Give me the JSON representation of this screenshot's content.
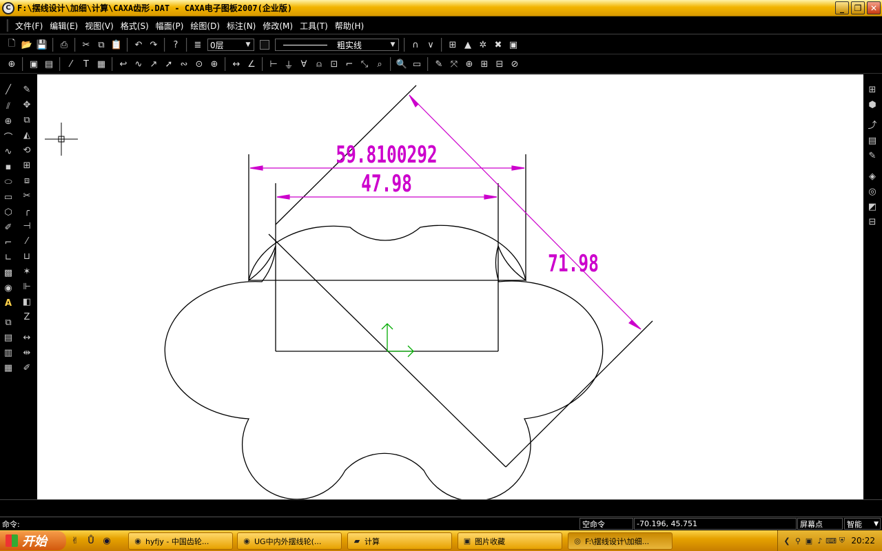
{
  "window": {
    "app_icon": "caxa-logo-icon",
    "title": "F:\\摆线设计\\加细\\计算\\CAXA齿形.DAT - CAXA电子图板2007(企业版)",
    "buttons": {
      "minimize": "_",
      "restore": "❐",
      "close": "✕"
    }
  },
  "menubar": {
    "items": [
      "文件(F)",
      "编辑(E)",
      "视图(V)",
      "格式(S)",
      "幅面(P)",
      "绘图(D)",
      "标注(N)",
      "修改(M)",
      "工具(T)",
      "帮助(H)"
    ]
  },
  "toolbar1": {
    "layer_value": "0层",
    "linetype_value": "粗实线",
    "icons": [
      "new-file-icon",
      "open-file-icon",
      "save-icon",
      "print-icon",
      "cut-icon",
      "copy-icon",
      "paste-icon",
      "undo-icon",
      "redo-icon",
      "help-icon"
    ]
  },
  "drawing": {
    "dim_horizontal_outer": "59.8100292",
    "dim_horizontal_inner": "47.98",
    "dim_aligned": "71.98",
    "colors": {
      "dimension": "#cc00cc",
      "geometry": "#000000",
      "ucs": "#00aa00",
      "canvas": "#ffffff"
    }
  },
  "status": {
    "command_label": "命令:",
    "mode": "空命令",
    "coordinates": "-70.196, 45.751",
    "snap_label": "屏幕点",
    "snap_mode": "智能"
  },
  "taskbar": {
    "start_label": "开始",
    "tasks": [
      {
        "label": "hyfjy - 中国齿轮...",
        "icon": "browser-icon"
      },
      {
        "label": "UG中内外摆线轮(...",
        "icon": "browser-icon"
      },
      {
        "label": "计算",
        "icon": "folder-icon"
      },
      {
        "label": "图片收藏",
        "icon": "picture-folder-icon"
      },
      {
        "label": "F:\\摆线设计\\加细...",
        "icon": "caxa-logo-icon"
      }
    ],
    "clock": "20:22"
  }
}
